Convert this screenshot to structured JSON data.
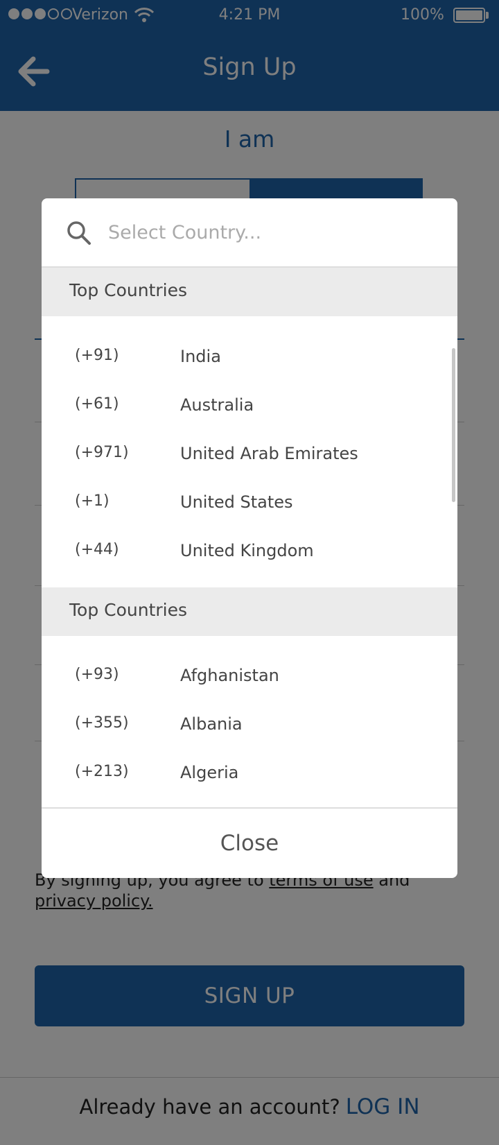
{
  "status_bar": {
    "carrier": "Verizon",
    "time": "4:21 PM",
    "battery": "100%",
    "signal_bars_filled": 3,
    "signal_bars_total": 5
  },
  "header": {
    "title": "Sign Up",
    "back_icon": "arrow-left-icon"
  },
  "form": {
    "iam_label": "I am",
    "terms": {
      "prefix": "By signing up, you agree to ",
      "terms_link": "terms of use",
      "middle": " and ",
      "privacy_link": "privacy policy."
    },
    "signup_button": "SIGN UP",
    "login_prompt": "Already have an account?",
    "login_link": "LOG IN"
  },
  "country_picker": {
    "search_placeholder": "Select Country...",
    "search_value": "",
    "sections": [
      {
        "title": "Top Countries",
        "countries": [
          {
            "code": "(+91)",
            "name": "India"
          },
          {
            "code": "(+61)",
            "name": "Australia"
          },
          {
            "code": "(+971)",
            "name": "United Arab Emirates"
          },
          {
            "code": "(+1)",
            "name": "United States"
          },
          {
            "code": "(+44)",
            "name": "United Kingdom"
          }
        ]
      },
      {
        "title": "Top Countries",
        "countries": [
          {
            "code": "(+93)",
            "name": "Afghanistan"
          },
          {
            "code": "(+355)",
            "name": "Albania"
          },
          {
            "code": "(+213)",
            "name": "Algeria"
          }
        ]
      }
    ],
    "close_label": "Close"
  },
  "colors": {
    "primary": "#1e64aa",
    "section_bg": "#ebebeb",
    "overlay": "rgba(0,0,0,0.5)"
  }
}
